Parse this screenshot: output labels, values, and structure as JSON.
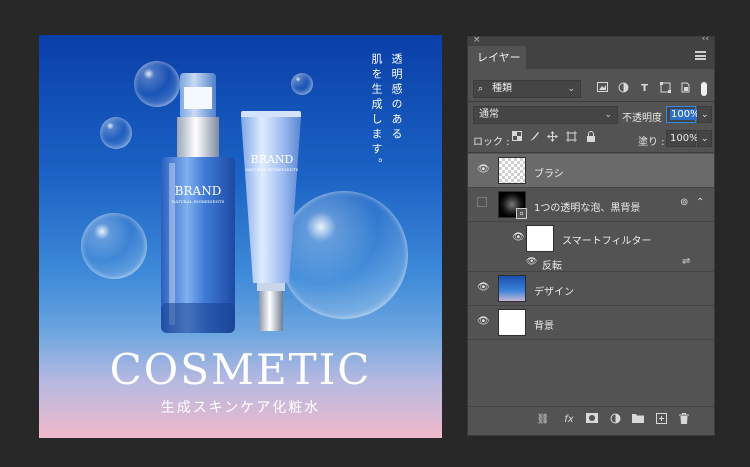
{
  "canvas": {
    "vertical_text_col1": "透明感のある",
    "vertical_text_col2": "肌を生成します。",
    "headline": "COSMETIC",
    "subline": "生成スキンケア化粧水",
    "bottle_brand": "BRAND",
    "bottle_tagline": "NATURAL INGREDIENTS",
    "tube_brand": "BRAND",
    "tube_tagline": "NATURAL INGREDIENTS"
  },
  "panel": {
    "close_glyph": "×",
    "collapse_glyph": "‹‹",
    "tab_label": "レイヤー",
    "filter": {
      "value": "種類",
      "icons": [
        "image-filter-icon",
        "adjustment-filter-icon",
        "type-filter-icon",
        "shape-filter-icon",
        "smart-object-filter-icon"
      ],
      "type_glyph": "T"
    },
    "blend_mode": "通常",
    "opacity_label": "不透明度 :",
    "opacity_value": "100%",
    "lock_label": "ロック :",
    "fill_label": "塗り :",
    "fill_value": "100%",
    "layers": [
      {
        "name": "ブラシ",
        "visible": true,
        "selected": true
      },
      {
        "name": "1つの透明な泡、黒背景",
        "visible": false,
        "selected": false
      },
      {
        "name": "スマートフィルター",
        "visible": true,
        "selected": false
      },
      {
        "name": "反転",
        "visible": true,
        "selected": false
      },
      {
        "name": "デザイン",
        "visible": true,
        "selected": false
      },
      {
        "name": "背景",
        "visible": true,
        "selected": false
      }
    ],
    "fx_label": "fx"
  },
  "colors": {
    "app_bg": "#282828",
    "panel_bg": "#535353",
    "selected_row": "#6a6a6a",
    "accent": "#2d8ceb"
  }
}
